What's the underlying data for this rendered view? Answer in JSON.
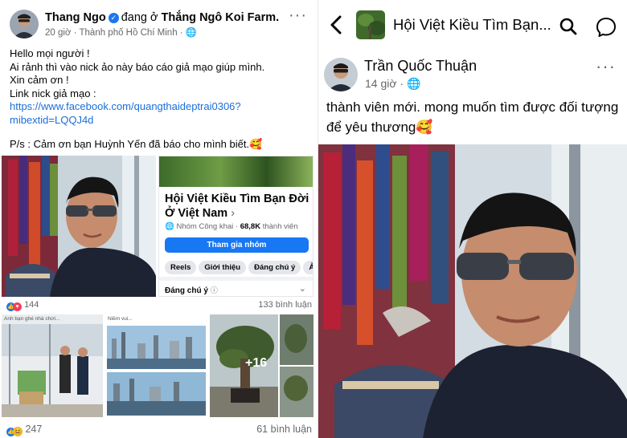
{
  "left_post": {
    "author": "Thang Ngo",
    "location_prefix": "đang ở",
    "location": "Thắng Ngô Koi Farm.",
    "time": "20 giờ",
    "city": "Thành phố Hồ Chí Minh",
    "more_label": "···",
    "lines": [
      "Hello mọi người !",
      "Ai rảnh thì vào nick ảo này báo cáo giả mạo giúp mình.",
      "Xin cảm ơn !",
      "Link nick giả mạo :"
    ],
    "link_line1": "https://www.facebook.com/quangthaideptrai0306?",
    "link_line2": "mibextid=LQQJ4d",
    "ps": "P/s :  Cảm ơn bạn Huỳnh Yến đã báo cho mình biết.🥰",
    "group_card": {
      "title": "Hội Việt Kiều Tìm Bạn Đời Ở Việt Nam",
      "chevron": "›",
      "privacy": "Nhóm Công khai",
      "members_count": "68,8K",
      "members_label": "thành viên",
      "join_button": "Tham gia nhóm",
      "chips": [
        "Reels",
        "Giới thiệu",
        "Đáng chú ý",
        "Ả"
      ],
      "featured": "Đáng chú ý",
      "info_icon": "ⓘ",
      "expand_icon": "⌄"
    },
    "reactions_1": "144",
    "comments_1": "133 bình luận",
    "photo_caption_1": "Anh bạn ghé nhà chơi...",
    "photo_caption_2": "Niềm vui...",
    "more_photos": "+16",
    "reactions_2": "247",
    "comments_2": "61 bình luận"
  },
  "right_post": {
    "group_title": "Hội Việt Kiều Tìm Bạn...",
    "author": "Trần Quốc Thuận",
    "time": "14 giờ",
    "more_label": "···",
    "text": "thành viên mới. mong muốn tìm được đối tượng để yêu thương🥰"
  },
  "colors": {
    "facebook_blue": "#1877f2",
    "link_blue": "#1a6ed8",
    "secondary_text": "#65676b"
  }
}
